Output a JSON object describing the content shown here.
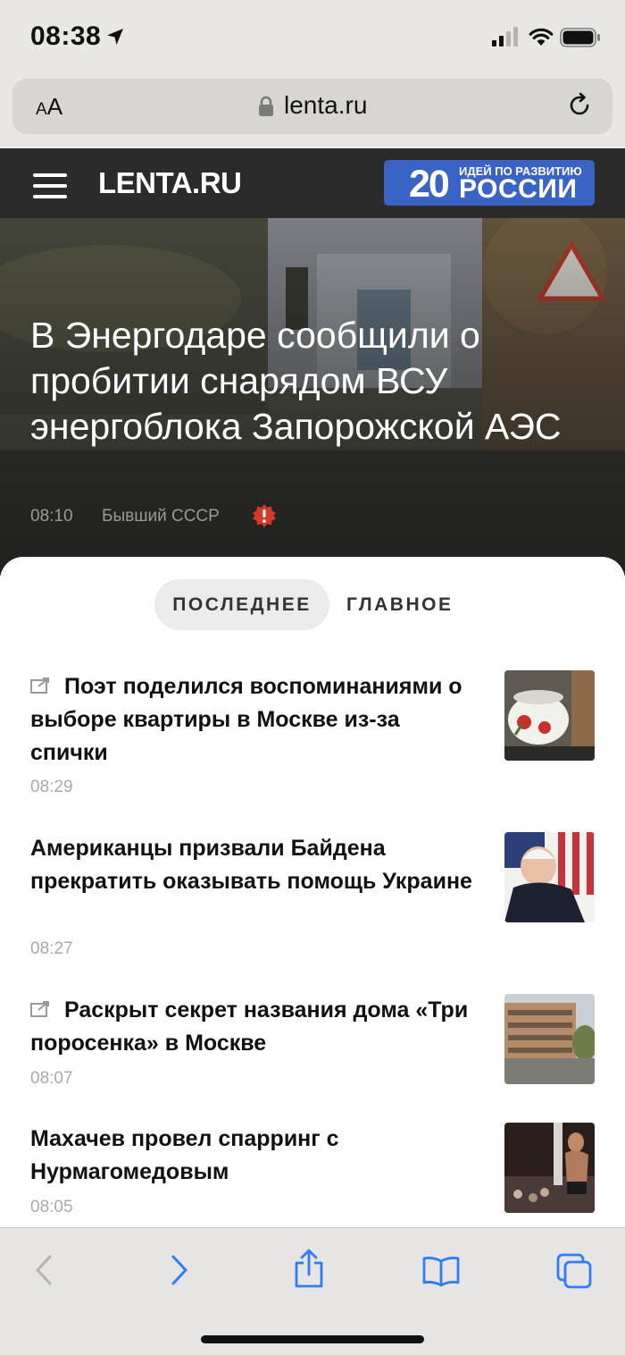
{
  "status_bar": {
    "time": "08:38"
  },
  "browser": {
    "text_size_label_small": "A",
    "text_size_label_big": "A",
    "url": "lenta.ru"
  },
  "site": {
    "logo": "LENTA.RU",
    "promo": {
      "number": "20",
      "top_line": "ИДЕЙ ПО РАЗВИТИЮ",
      "big_line": "РОССИИ"
    }
  },
  "hero": {
    "title": "В Энергодаре сообщили о пробитии снарядом ВСУ энергоблока Запорожской АЭС",
    "time": "08:10",
    "rubric": "Бывший СССР"
  },
  "tabs": [
    {
      "label": "ПОСЛЕДНЕЕ",
      "active": true
    },
    {
      "label": "ГЛАВНОЕ",
      "active": false
    }
  ],
  "news": [
    {
      "title": "Поэт поделился воспоминаниями о выборе квартиры в Москве из-за спички",
      "time": "08:29",
      "external": true,
      "thumb_icon": "teapot-photo"
    },
    {
      "title": "Американцы призвали Байдена прекратить оказывать помощь Украине",
      "time": "08:27",
      "external": false,
      "thumb_icon": "biden-photo"
    },
    {
      "title": "Раскрыт секрет названия дома «Три поросенка» в Москве",
      "time": "08:07",
      "external": true,
      "thumb_icon": "building-photo"
    },
    {
      "title": "Махачев провел спарринг с Нурмагомедовым",
      "time": "08:05",
      "external": false,
      "thumb_icon": "fighter-photo"
    }
  ],
  "colors": {
    "header_bg": "#2b2b2b",
    "promo_bg": "#3a63c6",
    "ios_blue": "#2f7cf6",
    "alert_red": "#d63a2c"
  }
}
